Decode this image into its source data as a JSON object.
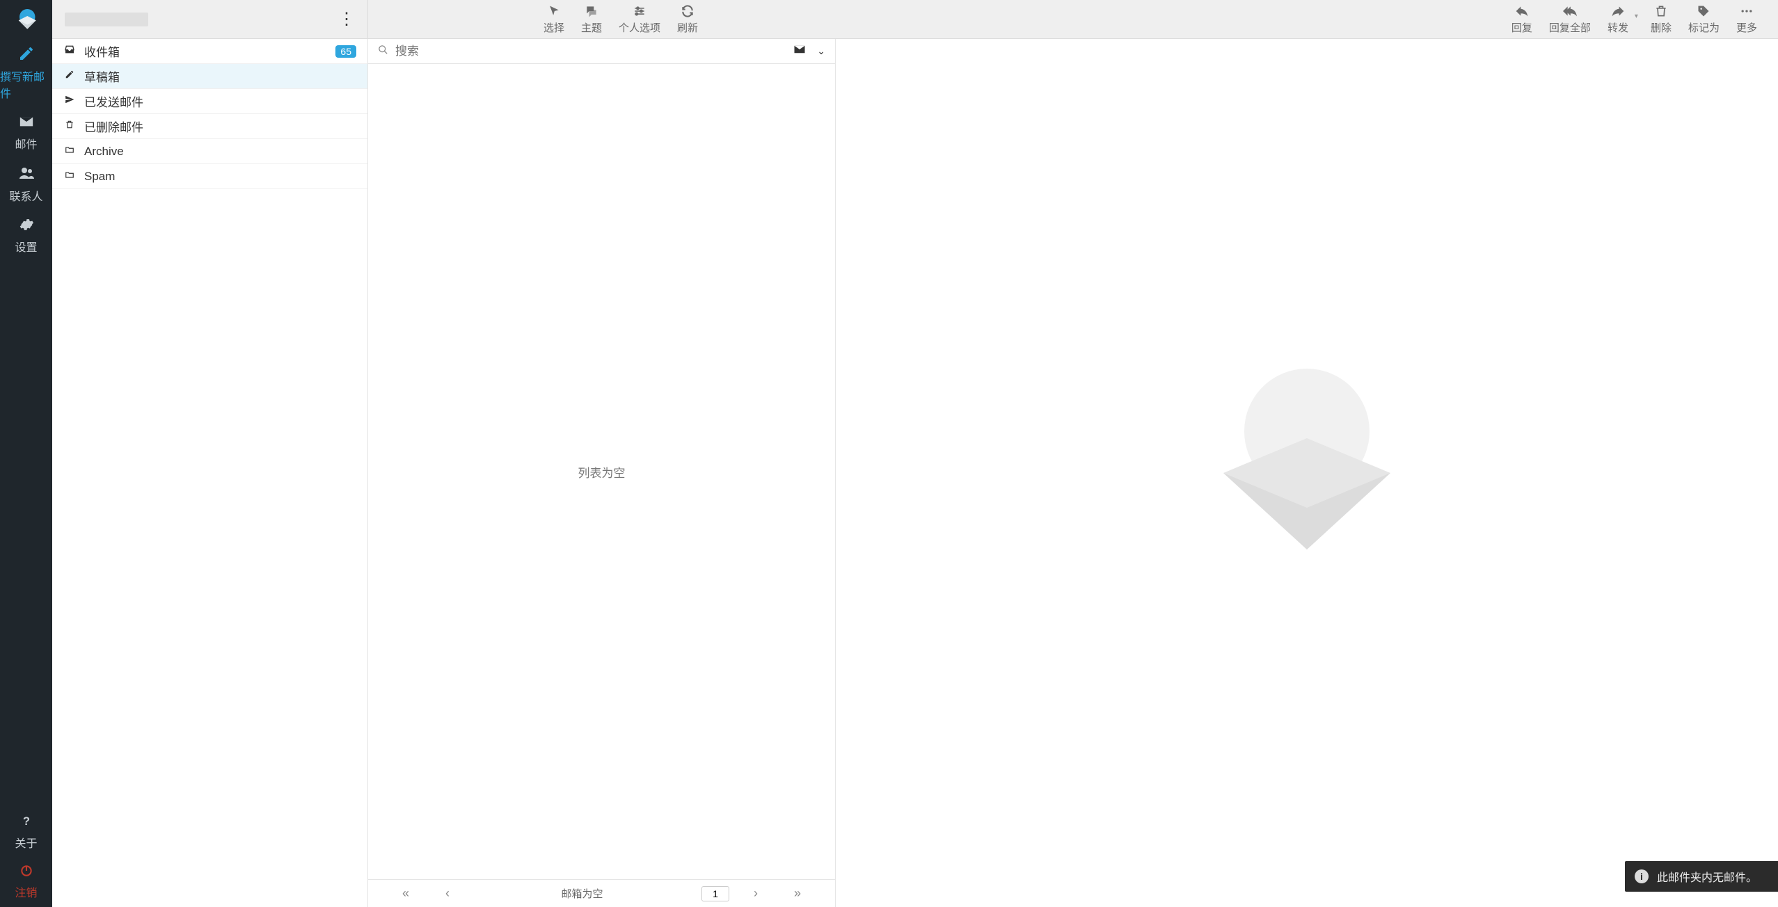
{
  "nav": {
    "items": [
      {
        "id": "compose",
        "label": "撰写新邮件"
      },
      {
        "id": "mail",
        "label": "邮件"
      },
      {
        "id": "contacts",
        "label": "联系人"
      },
      {
        "id": "settings",
        "label": "设置"
      }
    ],
    "bottom": [
      {
        "id": "about",
        "label": "关于"
      },
      {
        "id": "logout",
        "label": "注销"
      }
    ]
  },
  "account": {
    "name": ""
  },
  "toolbar_left": [
    {
      "id": "select",
      "label": "选择"
    },
    {
      "id": "threads",
      "label": "主题"
    },
    {
      "id": "options",
      "label": "个人选项"
    },
    {
      "id": "refresh",
      "label": "刷新"
    }
  ],
  "toolbar_right": [
    {
      "id": "reply",
      "label": "回复"
    },
    {
      "id": "replyall",
      "label": "回复全部"
    },
    {
      "id": "forward",
      "label": "转发"
    },
    {
      "id": "delete",
      "label": "删除"
    },
    {
      "id": "mark",
      "label": "标记为"
    },
    {
      "id": "more",
      "label": "更多"
    }
  ],
  "folders": [
    {
      "id": "inbox",
      "label": "收件箱",
      "badge": "65"
    },
    {
      "id": "drafts",
      "label": "草稿箱"
    },
    {
      "id": "sent",
      "label": "已发送邮件"
    },
    {
      "id": "trash",
      "label": "已删除邮件"
    },
    {
      "id": "archive",
      "label": "Archive"
    },
    {
      "id": "spam",
      "label": "Spam"
    }
  ],
  "search": {
    "placeholder": "搜索"
  },
  "list": {
    "empty": "列表为空"
  },
  "pager": {
    "status": "邮箱为空",
    "page": "1"
  },
  "toast": {
    "text": "此邮件夹内无邮件。"
  }
}
